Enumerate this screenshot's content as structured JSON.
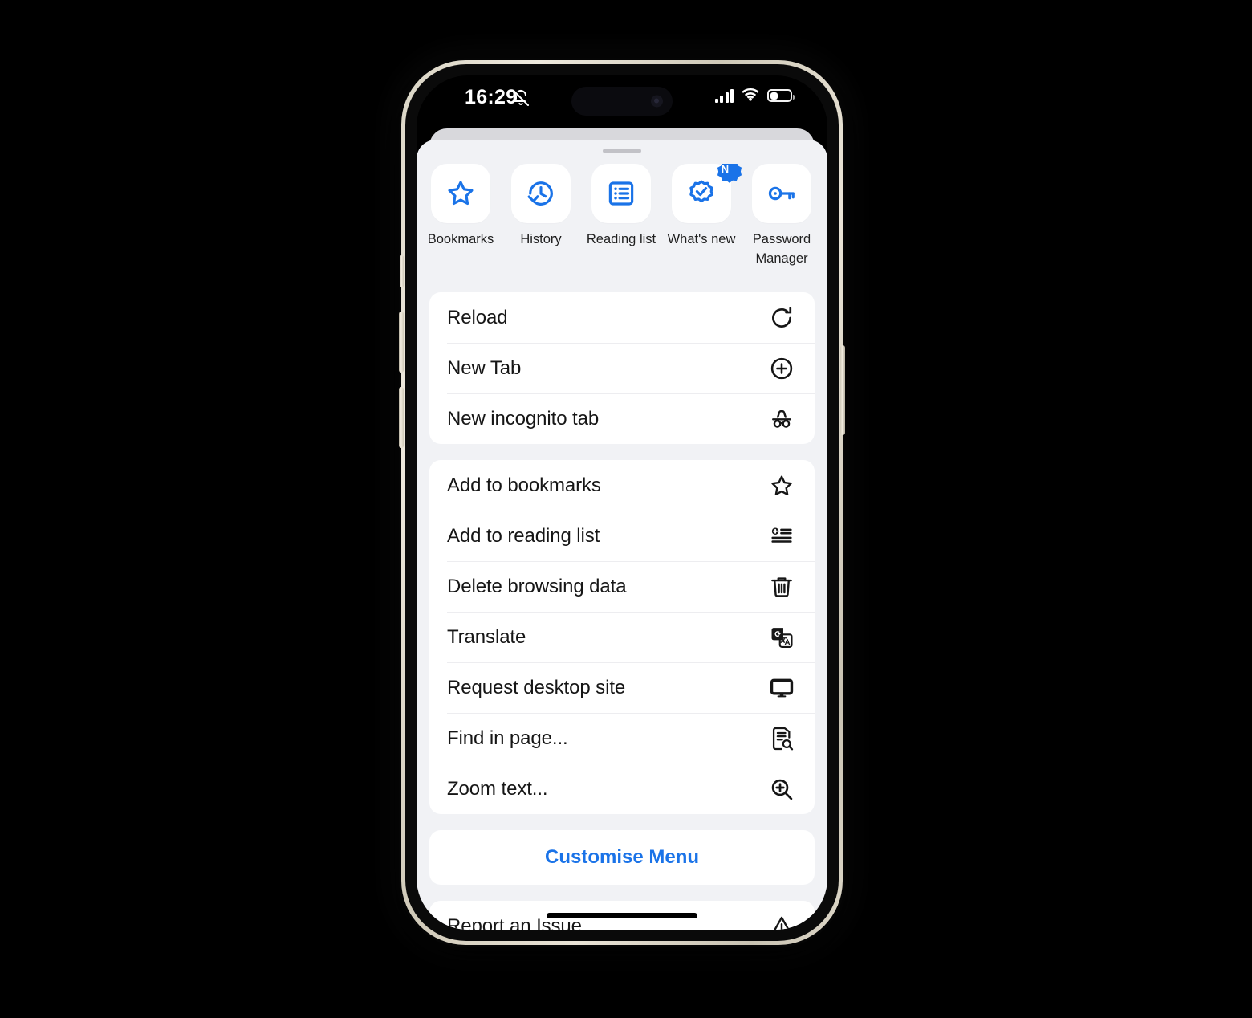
{
  "status_bar": {
    "time": "16:29",
    "silent_icon": "bell-slash-icon",
    "cellular_icon": "cellular-bars-icon",
    "wifi_icon": "wifi-icon",
    "battery_icon": "battery-low-icon"
  },
  "sheet": {
    "grabber": "drag-handle"
  },
  "shortcuts": [
    {
      "label": "Bookmarks",
      "icon": "star-outline-icon",
      "badge": null
    },
    {
      "label": "History",
      "icon": "history-clock-icon",
      "badge": null
    },
    {
      "label": "Reading list",
      "icon": "reading-list-icon",
      "badge": null
    },
    {
      "label": "What's new",
      "icon": "new-badge-check-icon",
      "badge": "N"
    },
    {
      "label": "Password Manager",
      "icon": "key-icon",
      "badge": null
    }
  ],
  "menu_groups": [
    {
      "name": "tabs-group",
      "items": [
        {
          "label": "Reload",
          "icon": "reload-icon"
        },
        {
          "label": "New Tab",
          "icon": "plus-circle-icon"
        },
        {
          "label": "New incognito tab",
          "icon": "incognito-icon"
        }
      ]
    },
    {
      "name": "page-actions-group",
      "items": [
        {
          "label": "Add to bookmarks",
          "icon": "star-outline-icon"
        },
        {
          "label": "Add to reading list",
          "icon": "add-reading-list-icon"
        },
        {
          "label": "Delete browsing data",
          "icon": "trash-icon"
        },
        {
          "label": "Translate",
          "icon": "translate-icon"
        },
        {
          "label": "Request desktop site",
          "icon": "desktop-monitor-icon"
        },
        {
          "label": "Find in page...",
          "icon": "find-in-page-icon"
        },
        {
          "label": "Zoom text...",
          "icon": "zoom-in-icon"
        }
      ]
    }
  ],
  "customise": {
    "label": "Customise Menu"
  },
  "footer_group": {
    "items": [
      {
        "label": "Report an Issue",
        "icon": "warning-triangle-icon"
      }
    ]
  },
  "colors": {
    "accent_blue": "#1a73e8",
    "sheet_background": "#f1f2f5",
    "card_background": "#ffffff",
    "text_primary": "#161616",
    "divider": "#ededf0"
  }
}
